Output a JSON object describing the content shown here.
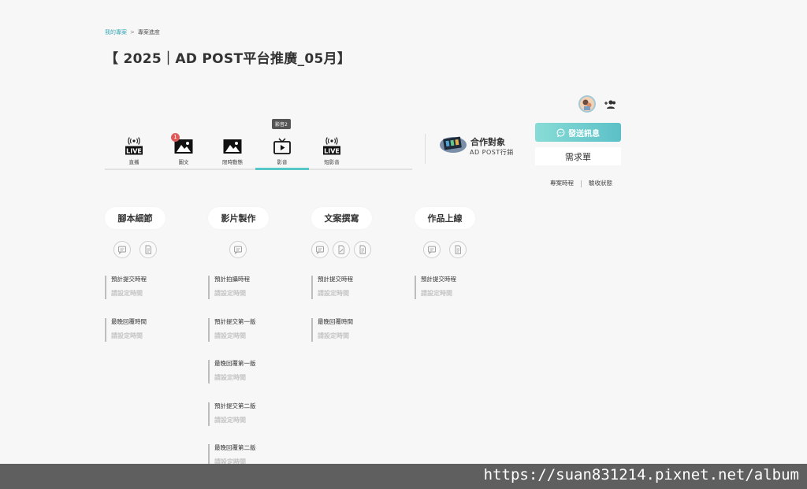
{
  "breadcrumb": {
    "parent": "我的專案",
    "separator": ">",
    "current": "專案進度"
  },
  "page_title": "【 2025｜AD POST平台推廣_05月】",
  "tabs": [
    {
      "label": "直播",
      "icon": "live-icon"
    },
    {
      "label": "圖文",
      "icon": "image-icon",
      "badge": "1"
    },
    {
      "label": "限時動態",
      "icon": "image-icon"
    },
    {
      "label": "影音",
      "icon": "video-icon",
      "tooltip": "影音2",
      "active": true
    },
    {
      "label": "短影音",
      "icon": "live-icon"
    }
  ],
  "partner": {
    "title": "合作對象",
    "name": "AD POST行銷"
  },
  "actions": {
    "send_message": "發送訊息",
    "request_form": "需求單"
  },
  "links": {
    "schedule": "專案時程",
    "acceptance": "驗收狀態"
  },
  "columns": [
    {
      "title": "腳本細節",
      "fields": [
        {
          "label": "預計提交時程",
          "value": "請設定時間"
        },
        {
          "label": "最晚回覆時間",
          "value": "請設定時間"
        }
      ]
    },
    {
      "title": "影片製作",
      "fields": [
        {
          "label": "預計拍攝時程",
          "value": "請設定時間"
        },
        {
          "label": "預計提交第一版",
          "value": "請設定時間"
        },
        {
          "label": "最晚回覆第一版",
          "value": "請設定時間"
        },
        {
          "label": "預計提交第二版",
          "value": "請設定時間"
        },
        {
          "label": "最晚回覆第二版",
          "value": "請設定時間"
        }
      ]
    },
    {
      "title": "文案撰寫",
      "fields": [
        {
          "label": "預計提交時程",
          "value": "請設定時間"
        },
        {
          "label": "最晚回覆時間",
          "value": "請設定時間"
        }
      ]
    },
    {
      "title": "作品上線",
      "fields": [
        {
          "label": "預計提交時程",
          "value": "請設定時間"
        }
      ]
    }
  ],
  "watermark": "https://suan831214.pixnet.net/album",
  "colors": {
    "accent": "#58c7c7",
    "link": "#3aa8b8",
    "badge": "#e05a5a",
    "footer": "#5f5f5f"
  }
}
